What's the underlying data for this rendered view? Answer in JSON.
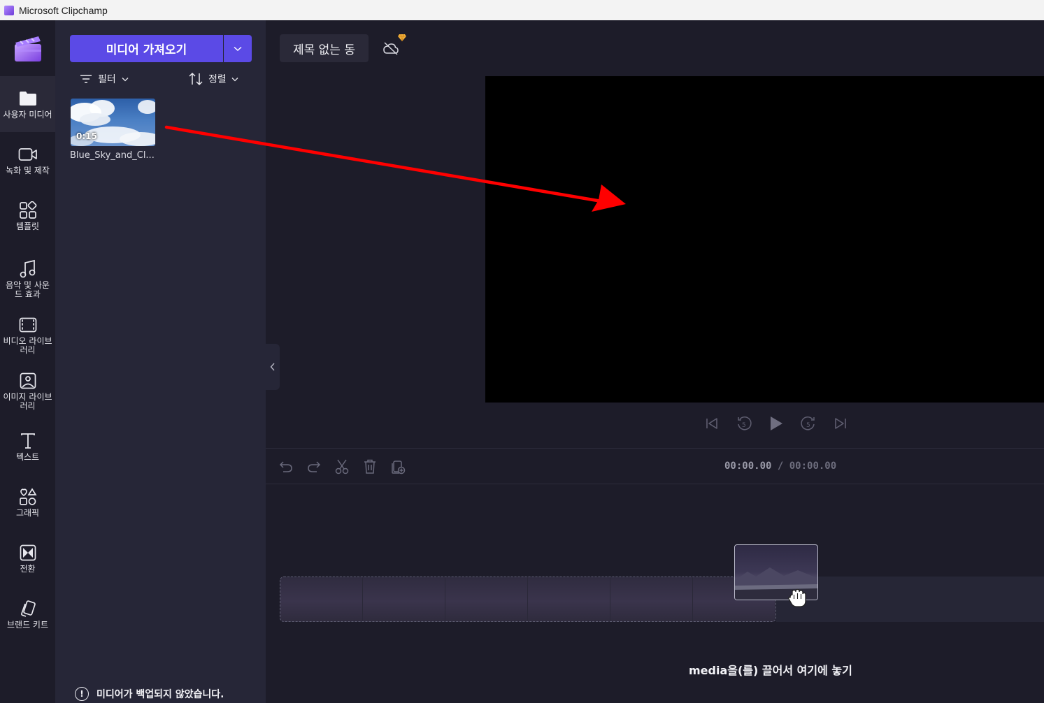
{
  "window": {
    "title": "Microsoft Clipchamp"
  },
  "rail": {
    "items": [
      {
        "label": "사용자 미디어",
        "icon": "folder-icon",
        "active": true
      },
      {
        "label": "녹화 및 제작",
        "icon": "video-camera-icon"
      },
      {
        "label": "템플릿",
        "icon": "templates-icon"
      },
      {
        "label": "음악 및 사운드 효과",
        "icon": "music-note-icon"
      },
      {
        "label": "비디오 라이브러리",
        "icon": "film-icon"
      },
      {
        "label": "이미지 라이브러리",
        "icon": "image-icon"
      },
      {
        "label": "텍스트",
        "icon": "text-icon"
      },
      {
        "label": "그래픽",
        "icon": "shapes-icon"
      },
      {
        "label": "전환",
        "icon": "transition-icon"
      },
      {
        "label": "브랜드 키트",
        "icon": "brand-kit-icon"
      }
    ]
  },
  "media": {
    "import_label": "미디어 가져오기",
    "filter_label": "필터",
    "sort_label": "정렬",
    "items": [
      {
        "name": "Blue_Sky_and_Cl...",
        "duration": "0:15"
      }
    ],
    "backup_warning": "미디어가 백업되지 않았습니다."
  },
  "project": {
    "title": "제목 없는 동"
  },
  "timeline": {
    "current_time": "00:00.00",
    "separator": " / ",
    "total_time": "00:00.00",
    "drop_hint": "media을(를) 끌어서 여기에 놓기"
  },
  "colors": {
    "accent": "#5b4ae6",
    "annotation": "#ff0000"
  }
}
